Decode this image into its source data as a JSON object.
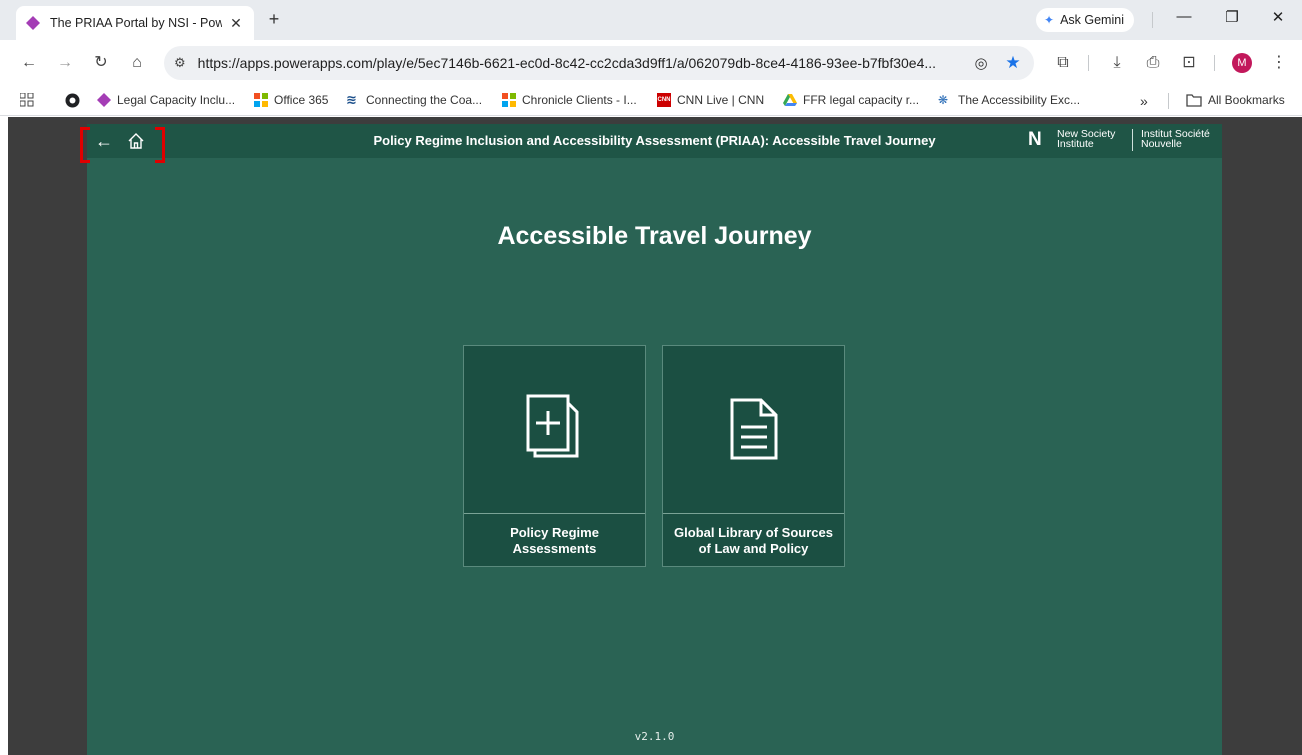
{
  "browser": {
    "tab": {
      "title": "The PRIAA Portal by NSI - Powe",
      "close": "✕"
    },
    "new_tab": "+",
    "gemini": "Ask Gemini",
    "window": {
      "minimize": "—",
      "restore": "❐",
      "close": "✕"
    },
    "nav": {
      "back": "←",
      "forward": "→",
      "reload": "↻",
      "home": "⌂"
    },
    "url": "https://apps.powerapps.com/play/e/5ec7146b-6621-ec0d-8c42-cc2cda3d9ff1/a/062079db-8ce4-4186-93ee-b7fbf30e4...",
    "avatar": "M",
    "bookmarks": [
      {
        "label": "Legal Capacity Inclu..."
      },
      {
        "label": "Office 365"
      },
      {
        "label": "Connecting the Coa..."
      },
      {
        "label": "Chronicle Clients - I..."
      },
      {
        "label": "CNN Live | CNN"
      },
      {
        "label": "FFR legal capacity r..."
      },
      {
        "label": "The Accessibility Exc..."
      }
    ],
    "more_bookmarks": "»",
    "all_bookmarks": "All Bookmarks"
  },
  "app": {
    "title": "Policy Regime Inclusion and Accessibility Assessment (PRIAA): Accessible Travel Journey",
    "logo_en_1": "New Society",
    "logo_en_2": "Institute",
    "logo_fr_1": "Institut Société",
    "logo_fr_2": "Nouvelle",
    "heading": "Accessible Travel Journey",
    "cards": [
      {
        "label": "Policy Regime Assessments"
      },
      {
        "label": "Global Library of Sources of Law and Policy"
      }
    ],
    "version": "v2.1.0",
    "colors": {
      "background": "#2a6354",
      "header": "#1f5546",
      "card": "#1b4f42",
      "highlight": "#e00000"
    }
  }
}
